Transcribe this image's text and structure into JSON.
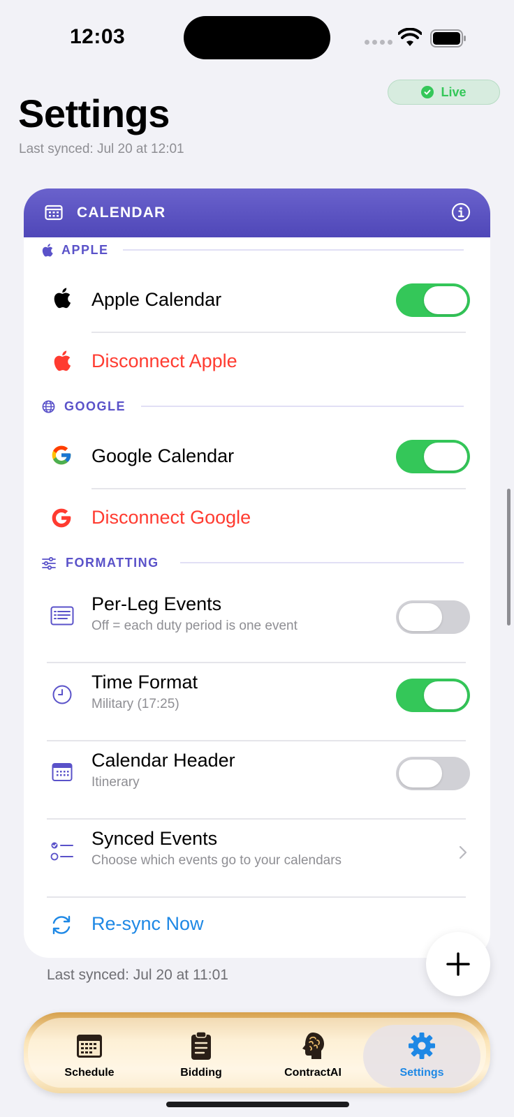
{
  "status_bar": {
    "time": "12:03"
  },
  "header": {
    "live_label": "Live",
    "title": "Settings",
    "last_synced": "Last synced: Jul 20 at 12:01"
  },
  "card": {
    "title": "CALENDAR",
    "sections": {
      "apple": {
        "label": "APPLE",
        "calendar_label": "Apple Calendar",
        "calendar_on": true,
        "disconnect_label": "Disconnect Apple"
      },
      "google": {
        "label": "GOOGLE",
        "calendar_label": "Google Calendar",
        "calendar_on": true,
        "disconnect_label": "Disconnect Google"
      },
      "formatting": {
        "label": "FORMATTING",
        "per_leg": {
          "title": "Per-Leg Events",
          "subtitle": "Off = each duty period is one event",
          "on": false
        },
        "time_format": {
          "title": "Time Format",
          "subtitle": "Military (17:25)",
          "on": true
        },
        "calendar_header": {
          "title": "Calendar Header",
          "subtitle": "Itinerary",
          "on": false
        },
        "synced_events": {
          "title": "Synced Events",
          "subtitle": "Choose which events go to your calendars"
        },
        "resync_label": "Re-sync Now"
      }
    }
  },
  "footer_last_synced": "Last synced: Jul 20 at 11:01",
  "tab_bar": {
    "tabs": [
      {
        "label": "Schedule",
        "icon": "calendar-icon"
      },
      {
        "label": "Bidding",
        "icon": "clipboard-icon"
      },
      {
        "label": "ContractAI",
        "icon": "brain-icon"
      },
      {
        "label": "Settings",
        "icon": "gear-icon",
        "selected": true
      }
    ]
  },
  "colors": {
    "accent": "#5a52c9",
    "green": "#34c759",
    "red": "#ff3b30",
    "blue": "#1e88e5",
    "selected_tab": "#1e88e5"
  }
}
